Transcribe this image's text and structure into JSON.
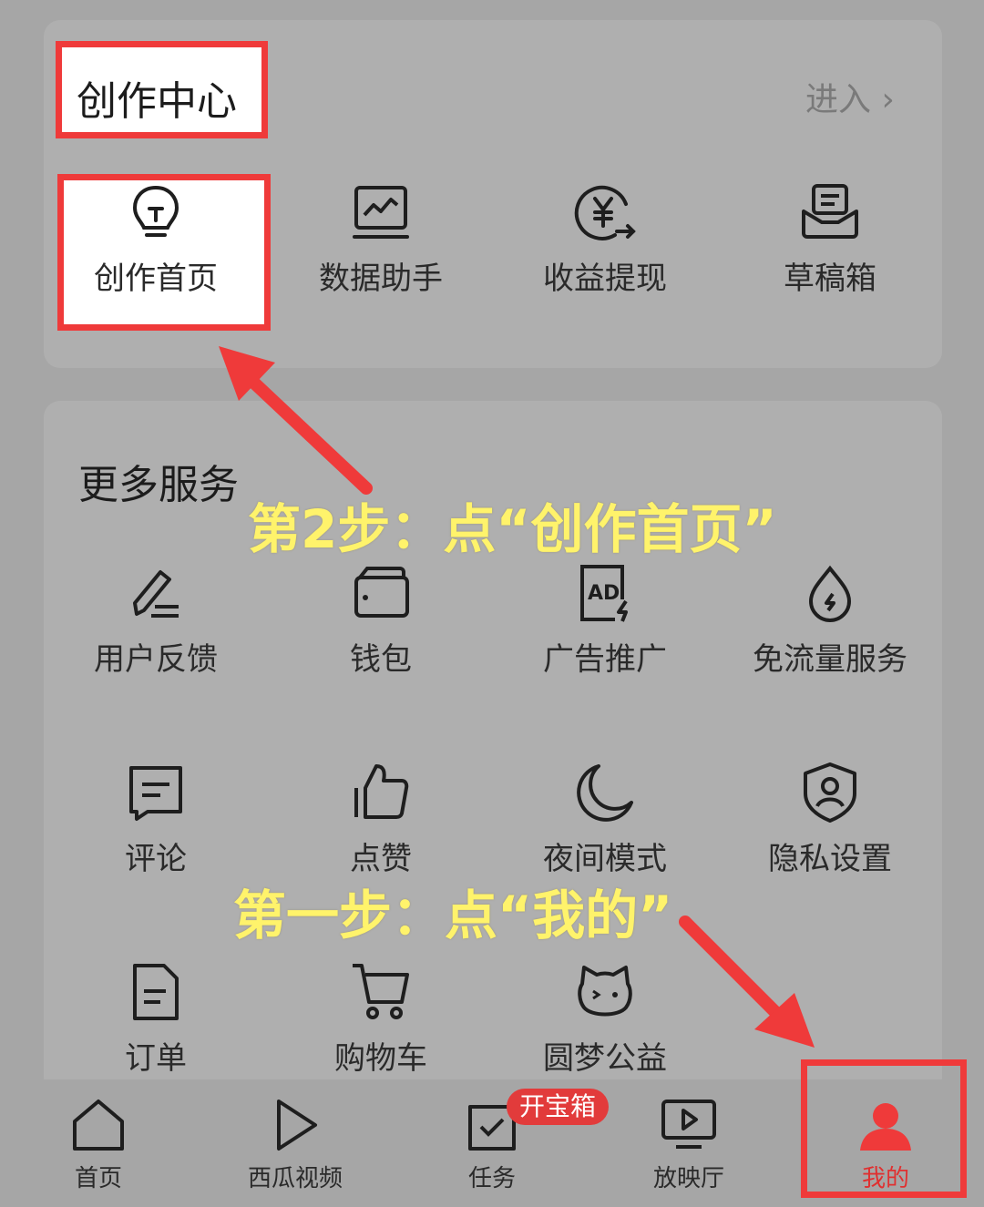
{
  "creation_center": {
    "title": "创作中心",
    "enter_label": "进入 ›",
    "items": [
      {
        "label": "创作首页",
        "icon": "lightbulb-icon"
      },
      {
        "label": "数据助手",
        "icon": "chart-monitor-icon"
      },
      {
        "label": "收益提现",
        "icon": "yen-withdraw-icon"
      },
      {
        "label": "草稿箱",
        "icon": "draft-box-icon"
      }
    ]
  },
  "more_services": {
    "title": "更多服务",
    "items": [
      {
        "label": "用户反馈",
        "icon": "pencil-icon"
      },
      {
        "label": "钱包",
        "icon": "wallet-icon"
      },
      {
        "label": "广告推广",
        "icon": "ad-icon"
      },
      {
        "label": "免流量服务",
        "icon": "drop-icon"
      },
      {
        "label": "评论",
        "icon": "comment-icon"
      },
      {
        "label": "点赞",
        "icon": "thumbs-up-icon"
      },
      {
        "label": "夜间模式",
        "icon": "moon-icon"
      },
      {
        "label": "隐私设置",
        "icon": "shield-user-icon"
      },
      {
        "label": "订单",
        "icon": "order-doc-icon"
      },
      {
        "label": "购物车",
        "icon": "cart-icon"
      },
      {
        "label": "圆梦公益",
        "icon": "charity-cat-icon"
      }
    ]
  },
  "annotations": {
    "step2": "第2步：点“创作首页”",
    "step1": "第一步：点“我的”"
  },
  "tabbar": {
    "tabs": [
      {
        "label": "首页",
        "icon": "home-icon"
      },
      {
        "label": "西瓜视频",
        "icon": "play-icon"
      },
      {
        "label": "任务",
        "icon": "task-icon"
      },
      {
        "label": "放映厅",
        "icon": "screen-icon"
      },
      {
        "label": "我的",
        "icon": "user-icon"
      }
    ],
    "badge": "开宝箱"
  },
  "colors": {
    "highlight_red": "#ef3a3a",
    "annotation_yellow": "#fff36b",
    "background_gray": "#a6a6a6"
  }
}
